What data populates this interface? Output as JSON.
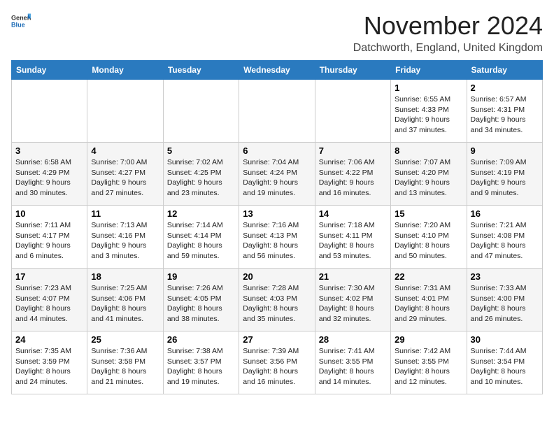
{
  "logo": {
    "general": "General",
    "blue": "Blue"
  },
  "title": "November 2024",
  "location": "Datchworth, England, United Kingdom",
  "days_of_week": [
    "Sunday",
    "Monday",
    "Tuesday",
    "Wednesday",
    "Thursday",
    "Friday",
    "Saturday"
  ],
  "weeks": [
    [
      {
        "day": "",
        "info": ""
      },
      {
        "day": "",
        "info": ""
      },
      {
        "day": "",
        "info": ""
      },
      {
        "day": "",
        "info": ""
      },
      {
        "day": "",
        "info": ""
      },
      {
        "day": "1",
        "info": "Sunrise: 6:55 AM\nSunset: 4:33 PM\nDaylight: 9 hours\nand 37 minutes."
      },
      {
        "day": "2",
        "info": "Sunrise: 6:57 AM\nSunset: 4:31 PM\nDaylight: 9 hours\nand 34 minutes."
      }
    ],
    [
      {
        "day": "3",
        "info": "Sunrise: 6:58 AM\nSunset: 4:29 PM\nDaylight: 9 hours\nand 30 minutes."
      },
      {
        "day": "4",
        "info": "Sunrise: 7:00 AM\nSunset: 4:27 PM\nDaylight: 9 hours\nand 27 minutes."
      },
      {
        "day": "5",
        "info": "Sunrise: 7:02 AM\nSunset: 4:25 PM\nDaylight: 9 hours\nand 23 minutes."
      },
      {
        "day": "6",
        "info": "Sunrise: 7:04 AM\nSunset: 4:24 PM\nDaylight: 9 hours\nand 19 minutes."
      },
      {
        "day": "7",
        "info": "Sunrise: 7:06 AM\nSunset: 4:22 PM\nDaylight: 9 hours\nand 16 minutes."
      },
      {
        "day": "8",
        "info": "Sunrise: 7:07 AM\nSunset: 4:20 PM\nDaylight: 9 hours\nand 13 minutes."
      },
      {
        "day": "9",
        "info": "Sunrise: 7:09 AM\nSunset: 4:19 PM\nDaylight: 9 hours\nand 9 minutes."
      }
    ],
    [
      {
        "day": "10",
        "info": "Sunrise: 7:11 AM\nSunset: 4:17 PM\nDaylight: 9 hours\nand 6 minutes."
      },
      {
        "day": "11",
        "info": "Sunrise: 7:13 AM\nSunset: 4:16 PM\nDaylight: 9 hours\nand 3 minutes."
      },
      {
        "day": "12",
        "info": "Sunrise: 7:14 AM\nSunset: 4:14 PM\nDaylight: 8 hours\nand 59 minutes."
      },
      {
        "day": "13",
        "info": "Sunrise: 7:16 AM\nSunset: 4:13 PM\nDaylight: 8 hours\nand 56 minutes."
      },
      {
        "day": "14",
        "info": "Sunrise: 7:18 AM\nSunset: 4:11 PM\nDaylight: 8 hours\nand 53 minutes."
      },
      {
        "day": "15",
        "info": "Sunrise: 7:20 AM\nSunset: 4:10 PM\nDaylight: 8 hours\nand 50 minutes."
      },
      {
        "day": "16",
        "info": "Sunrise: 7:21 AM\nSunset: 4:08 PM\nDaylight: 8 hours\nand 47 minutes."
      }
    ],
    [
      {
        "day": "17",
        "info": "Sunrise: 7:23 AM\nSunset: 4:07 PM\nDaylight: 8 hours\nand 44 minutes."
      },
      {
        "day": "18",
        "info": "Sunrise: 7:25 AM\nSunset: 4:06 PM\nDaylight: 8 hours\nand 41 minutes."
      },
      {
        "day": "19",
        "info": "Sunrise: 7:26 AM\nSunset: 4:05 PM\nDaylight: 8 hours\nand 38 minutes."
      },
      {
        "day": "20",
        "info": "Sunrise: 7:28 AM\nSunset: 4:03 PM\nDaylight: 8 hours\nand 35 minutes."
      },
      {
        "day": "21",
        "info": "Sunrise: 7:30 AM\nSunset: 4:02 PM\nDaylight: 8 hours\nand 32 minutes."
      },
      {
        "day": "22",
        "info": "Sunrise: 7:31 AM\nSunset: 4:01 PM\nDaylight: 8 hours\nand 29 minutes."
      },
      {
        "day": "23",
        "info": "Sunrise: 7:33 AM\nSunset: 4:00 PM\nDaylight: 8 hours\nand 26 minutes."
      }
    ],
    [
      {
        "day": "24",
        "info": "Sunrise: 7:35 AM\nSunset: 3:59 PM\nDaylight: 8 hours\nand 24 minutes."
      },
      {
        "day": "25",
        "info": "Sunrise: 7:36 AM\nSunset: 3:58 PM\nDaylight: 8 hours\nand 21 minutes."
      },
      {
        "day": "26",
        "info": "Sunrise: 7:38 AM\nSunset: 3:57 PM\nDaylight: 8 hours\nand 19 minutes."
      },
      {
        "day": "27",
        "info": "Sunrise: 7:39 AM\nSunset: 3:56 PM\nDaylight: 8 hours\nand 16 minutes."
      },
      {
        "day": "28",
        "info": "Sunrise: 7:41 AM\nSunset: 3:55 PM\nDaylight: 8 hours\nand 14 minutes."
      },
      {
        "day": "29",
        "info": "Sunrise: 7:42 AM\nSunset: 3:55 PM\nDaylight: 8 hours\nand 12 minutes."
      },
      {
        "day": "30",
        "info": "Sunrise: 7:44 AM\nSunset: 3:54 PM\nDaylight: 8 hours\nand 10 minutes."
      }
    ]
  ]
}
